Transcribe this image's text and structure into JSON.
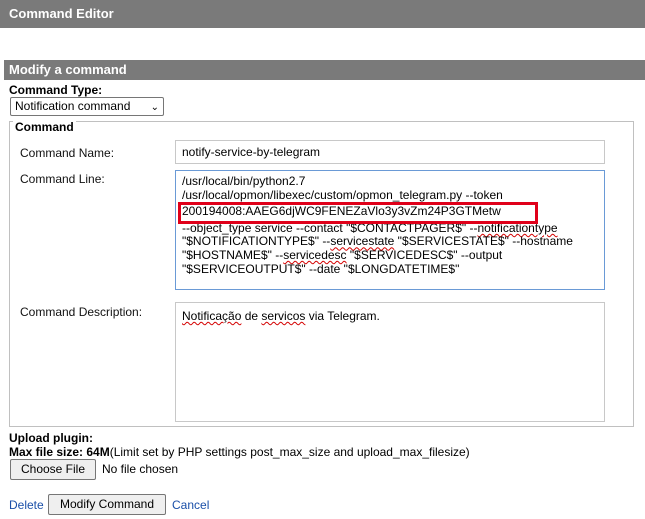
{
  "window": {
    "title": "Command Editor"
  },
  "section": {
    "title": "Modify a command"
  },
  "command_type": {
    "label": "Command Type:",
    "selected": "Notification command"
  },
  "fieldset": {
    "legend": "Command"
  },
  "command_name": {
    "label": "Command Name:",
    "value": "notify-service-by-telegram"
  },
  "command_line": {
    "label": "Command Line:",
    "line1": "/usr/local/bin/python2.7",
    "line2": "/usr/local/opmon/libexec/custom/opmon_telegram.py --token",
    "line3": "200194008:AAEG6djWC9FENEZaVlo3y3vZm24P3GTMetw",
    "rest_a": "--object_type service --contact \"$CONTACTPAGER$\" --",
    "rest_squig1": "notificationtype",
    "rest_b": " \"$NOTIFICATIONTYPE$\" --",
    "rest_squig2": "servicestate",
    "rest_c": " \"$SERVICESTATE$\" --hostname \"$HOSTNAME$\" --",
    "rest_squig3": "servicedesc",
    "rest_d": " \"$SERVICEDESC$\" --output \"$SERVICEOUTPUT$\" --date \"$LONGDATETIME$\""
  },
  "command_description": {
    "label": "Command Description:",
    "word1": "Notificação",
    "mid": " de ",
    "word2": "servicos",
    "end": " via Telegram."
  },
  "upload": {
    "label": "Upload plugin:",
    "max_label": "Max file size: 64M",
    "max_note": "(Limit set by PHP settings post_max_size and upload_max_filesize)",
    "choose_button": "Choose File",
    "no_file": "No file chosen"
  },
  "actions": {
    "delete": "Delete",
    "modify": "Modify Command",
    "cancel": "Cancel"
  },
  "colors": {
    "header_bg": "#7a7a7a",
    "highlight": "#e0001a",
    "link": "#1a4fa8"
  }
}
